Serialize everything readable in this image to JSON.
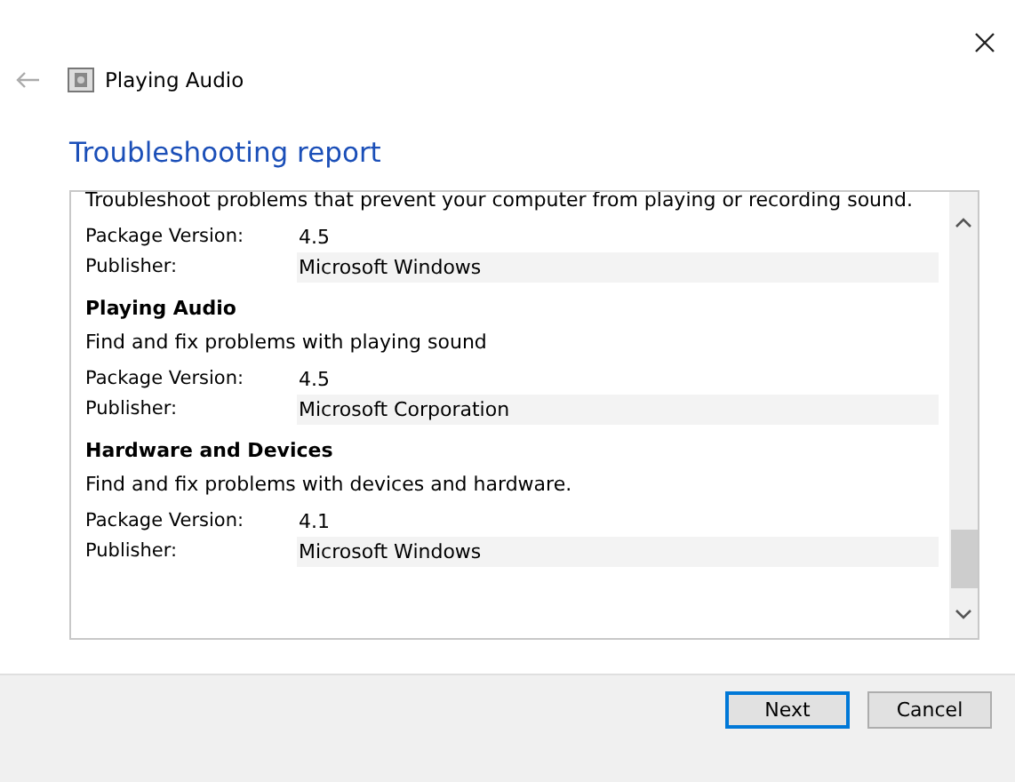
{
  "window": {
    "title": "Playing Audio"
  },
  "heading": "Troubleshooting report",
  "intro": "Troubleshoot problems that prevent your computer from playing or recording sound.",
  "intro_fields": [
    {
      "label": "Package Version:",
      "value": "4.5"
    },
    {
      "label": "Publisher:",
      "value": "Microsoft Windows"
    }
  ],
  "sections": [
    {
      "title": "Playing Audio",
      "description": "Find and fix problems with playing sound",
      "fields": [
        {
          "label": "Package Version:",
          "value": "4.5"
        },
        {
          "label": "Publisher:",
          "value": "Microsoft Corporation"
        }
      ]
    },
    {
      "title": "Hardware and Devices",
      "description": "Find and fix problems with devices and hardware.",
      "fields": [
        {
          "label": "Package Version:",
          "value": "4.1"
        },
        {
          "label": "Publisher:",
          "value": "Microsoft Windows"
        }
      ]
    }
  ],
  "buttons": [
    {
      "label": "Next",
      "selected": true
    },
    {
      "label": "Cancel",
      "selected": false
    }
  ]
}
